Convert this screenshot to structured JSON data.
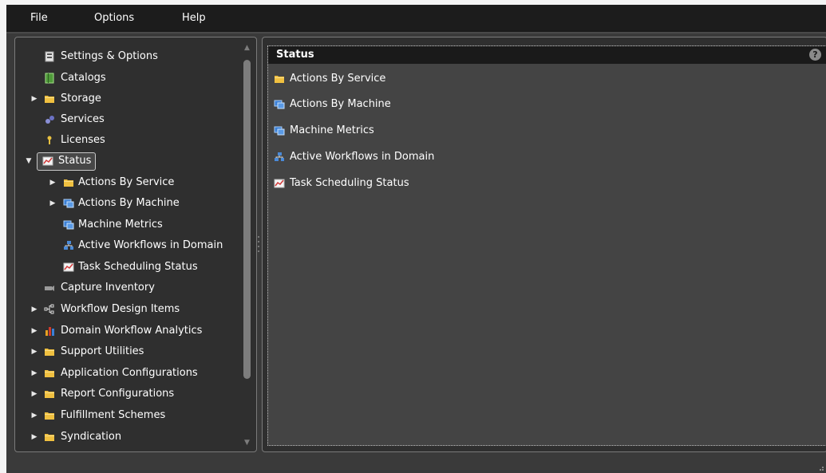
{
  "menu": {
    "file": "File",
    "options": "Options",
    "help": "Help"
  },
  "tree": {
    "items": [
      {
        "label": "Settings & Options",
        "icon": "settings-icon",
        "expandable": false
      },
      {
        "label": "Catalogs",
        "icon": "catalog-icon",
        "expandable": false
      },
      {
        "label": "Storage",
        "icon": "folder-icon",
        "expandable": true
      },
      {
        "label": "Services",
        "icon": "services-icon",
        "expandable": false
      },
      {
        "label": "Licenses",
        "icon": "key-icon",
        "expandable": false
      },
      {
        "label": "Status",
        "icon": "status-chart-icon",
        "expandable": true,
        "expanded": true,
        "selected": true
      },
      {
        "label": "Actions By Service",
        "icon": "folder-icon",
        "expandable": true
      },
      {
        "label": "Actions By Machine",
        "icon": "machine-icon",
        "expandable": true
      },
      {
        "label": "Machine Metrics",
        "icon": "machine-icon",
        "expandable": false
      },
      {
        "label": "Active Workflows in Domain",
        "icon": "network-icon",
        "expandable": false
      },
      {
        "label": "Task Scheduling Status",
        "icon": "status-chart-icon",
        "expandable": false
      },
      {
        "label": "Capture Inventory",
        "icon": "camera-icon",
        "expandable": false
      },
      {
        "label": "Workflow Design Items",
        "icon": "workflow-icon",
        "expandable": true
      },
      {
        "label": "Domain Workflow Analytics",
        "icon": "analytics-icon",
        "expandable": true
      },
      {
        "label": "Support Utilities",
        "icon": "folder-icon",
        "expandable": true
      },
      {
        "label": "Application Configurations",
        "icon": "folder-icon",
        "expandable": true
      },
      {
        "label": "Report Configurations",
        "icon": "folder-icon",
        "expandable": true
      },
      {
        "label": "Fulfillment Schemes",
        "icon": "folder-icon",
        "expandable": true
      },
      {
        "label": "Syndication",
        "icon": "folder-icon",
        "expandable": true
      }
    ]
  },
  "status_panel": {
    "title": "Status",
    "help": "?",
    "items": [
      {
        "label": "Actions By Service",
        "icon": "folder-icon"
      },
      {
        "label": "Actions By Machine",
        "icon": "machine-icon"
      },
      {
        "label": "Machine Metrics",
        "icon": "machine-icon"
      },
      {
        "label": "Active Workflows in Domain",
        "icon": "network-icon"
      },
      {
        "label": "Task Scheduling Status",
        "icon": "status-chart-icon"
      }
    ]
  },
  "colors": {
    "menubar": "#1c1c1c",
    "panel": "#2f2f2f",
    "content": "#444444",
    "folder": "#f0c040",
    "machine": "#3a7fd6"
  }
}
